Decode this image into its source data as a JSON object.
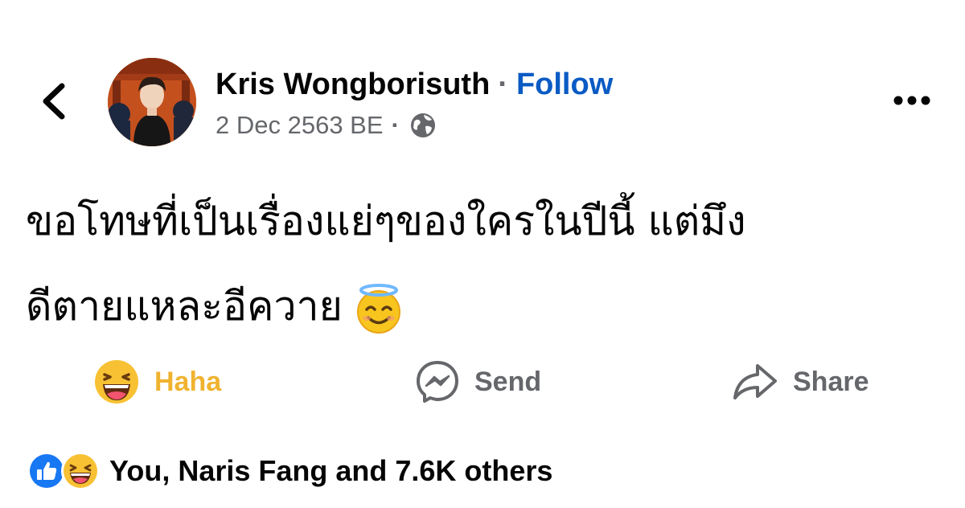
{
  "header": {
    "author_name": "Kris Wongborisuth",
    "separator": "·",
    "follow_label": "Follow",
    "timestamp": "2 Dec 2563 BE",
    "meta_separator": "·",
    "audience_icon": "globe-icon",
    "back_icon": "chevron-left-icon",
    "more_icon": "more-options-icon"
  },
  "post": {
    "text_line1": "ขอโทษที่เป็นเรื่องแย่ๆของใครในปีนี้ แต่มึง",
    "text_line2": "ดีตายแหละอีควาย",
    "emoji": "smiling-face-with-halo-emoji"
  },
  "actions": {
    "reaction_label": "Haha",
    "reaction_icon": "haha-reaction-icon",
    "send_label": "Send",
    "send_icon": "messenger-icon",
    "share_label": "Share",
    "share_icon": "share-arrow-icon"
  },
  "reactions": {
    "summary_text": "You, Naris Fang and 7.6K others",
    "icons": [
      "like-reaction-icon",
      "haha-reaction-icon"
    ]
  },
  "colors": {
    "follow": "#0a5bc4",
    "haha_active": "#f0b330",
    "muted": "#65676b",
    "text": "#050505",
    "like_blue": "#1877f2"
  }
}
